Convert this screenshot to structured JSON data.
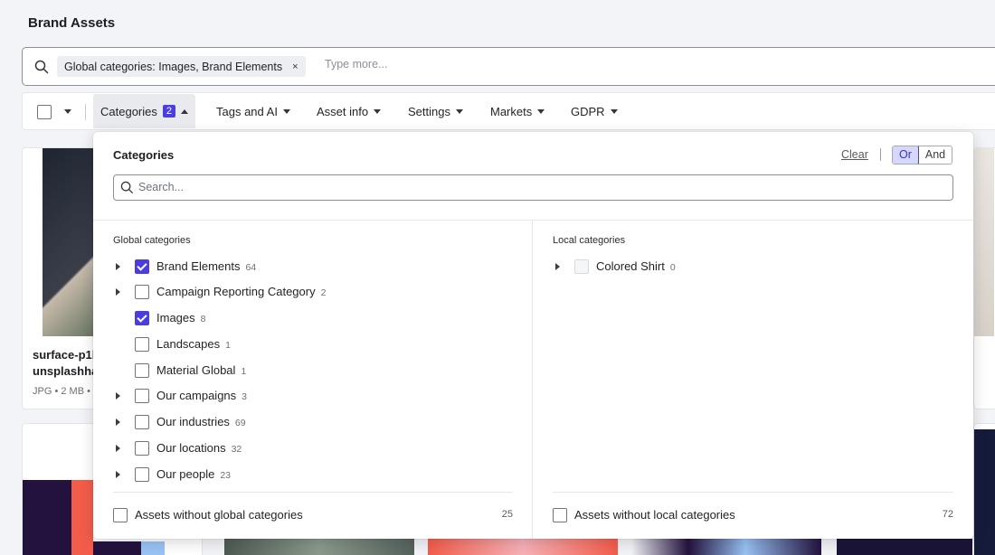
{
  "page": {
    "title": "Brand Assets"
  },
  "search": {
    "chip_label": "Global categories: Images, Brand Elements",
    "chip_remove": "×",
    "placeholder": "Type more..."
  },
  "toolbar": {
    "filters": [
      {
        "label": "Categories",
        "badge": "2"
      },
      {
        "label": "Tags and AI"
      },
      {
        "label": "Asset info"
      },
      {
        "label": "Settings"
      },
      {
        "label": "Markets"
      },
      {
        "label": "GDPR"
      }
    ]
  },
  "asset_card": {
    "name_line1": "surface-p1l",
    "name_line2": "unsplashha",
    "meta": "JPG • 2 MB •"
  },
  "categories_panel": {
    "title": "Categories",
    "clear_label": "Clear",
    "mode_or": "Or",
    "mode_and": "And",
    "mode_selected": "Or",
    "search_placeholder": "Search...",
    "global": {
      "heading": "Global categories",
      "items": [
        {
          "label": "Brand Elements",
          "count": "64",
          "checked": true,
          "expandable": true
        },
        {
          "label": "Campaign Reporting Category",
          "count": "2",
          "checked": false,
          "expandable": true
        },
        {
          "label": "Images",
          "count": "8",
          "checked": true,
          "expandable": false
        },
        {
          "label": "Landscapes",
          "count": "1",
          "checked": false,
          "expandable": false
        },
        {
          "label": "Material Global",
          "count": "1",
          "checked": false,
          "expandable": false
        },
        {
          "label": "Our campaigns",
          "count": "3",
          "checked": false,
          "expandable": true
        },
        {
          "label": "Our industries",
          "count": "69",
          "checked": false,
          "expandable": true
        },
        {
          "label": "Our locations",
          "count": "32",
          "checked": false,
          "expandable": true
        },
        {
          "label": "Our people",
          "count": "23",
          "checked": false,
          "expandable": true
        }
      ],
      "without_label": "Assets without global categories",
      "without_count": "25"
    },
    "local": {
      "heading": "Local categories",
      "items": [
        {
          "label": "Colored Shirt",
          "count": "0",
          "checked": false,
          "expandable": true,
          "disabled": true
        }
      ],
      "without_label": "Assets without local categories",
      "without_count": "72"
    }
  },
  "colors": {
    "accent": "#4c3de0",
    "accent_light": "#d6d8fb",
    "background": "#f3f4f7"
  }
}
